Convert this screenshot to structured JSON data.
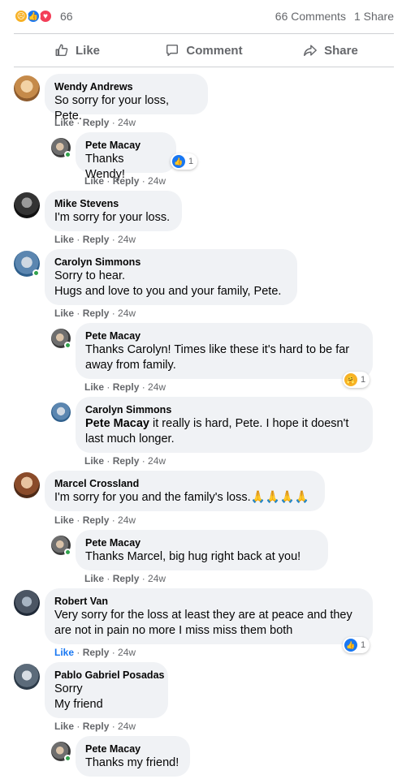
{
  "summary": {
    "reaction_icons": [
      "sad-reaction",
      "like-reaction",
      "love-reaction"
    ],
    "reaction_count": "66",
    "comments_count": "66 Comments",
    "shares_count": "1 Share"
  },
  "actions": {
    "like": "Like",
    "comment": "Comment",
    "share": "Share"
  },
  "colors": {
    "accent": "#1877f2",
    "bubble": "#f0f2f5",
    "meta": "#65676b",
    "online": "#31a24c"
  },
  "comments": [
    {
      "author": "Wendy Andrews",
      "lines": [
        "So sorry for your loss, Pete."
      ],
      "like": "Like",
      "reply": "Reply",
      "time": "24w"
    },
    {
      "author": "Pete Macay",
      "lines": [
        "Thanks Wendy!"
      ],
      "like": "Like",
      "reply": "Reply",
      "time": "24w",
      "reaction": {
        "icon": "like-reaction",
        "count": "1"
      }
    },
    {
      "author": "Mike Stevens",
      "lines": [
        "I'm sorry for your loss."
      ],
      "like": "Like",
      "reply": "Reply",
      "time": "24w"
    },
    {
      "author": "Carolyn Simmons",
      "lines": [
        "Sorry to hear.",
        "Hugs and love to you and your family, Pete."
      ],
      "like": "Like",
      "reply": "Reply",
      "time": "24w"
    },
    {
      "author": "Pete Macay",
      "lines": [
        "Thanks Carolyn! Times like these it's hard to be far",
        "away from family."
      ],
      "like": "Like",
      "reply": "Reply",
      "time": "24w",
      "reaction": {
        "icon": "care-reaction",
        "count": "1"
      }
    },
    {
      "author": "Carolyn Simmons",
      "mention": "Pete Macay",
      "lines": [
        " it really is hard, Pete. I hope it doesn't",
        "last much longer."
      ],
      "like": "Like",
      "reply": "Reply",
      "time": "24w"
    },
    {
      "author": "Marcel Crossland",
      "lines": [
        "I'm sorry for you and the family's loss.🙏🙏🙏🙏"
      ],
      "like": "Like",
      "reply": "Reply",
      "time": "24w"
    },
    {
      "author": "Pete Macay",
      "lines": [
        "Thanks Marcel, big hug right back at you!"
      ],
      "like": "Like",
      "reply": "Reply",
      "time": "24w"
    },
    {
      "author": "Robert Van",
      "lines": [
        "Very sorry for the loss at least they are at peace and they",
        "are not in pain no more I miss miss them both"
      ],
      "like": "Like",
      "reply": "Reply",
      "time": "24w",
      "reaction": {
        "icon": "like-reaction",
        "count": "1"
      }
    },
    {
      "author": "Pablo Gabriel Posadas",
      "lines": [
        "Sorry",
        "My friend"
      ],
      "like": "Like",
      "reply": "Reply",
      "time": "24w"
    },
    {
      "author": "Pete Macay",
      "lines": [
        "Thanks my friend!"
      ]
    }
  ]
}
